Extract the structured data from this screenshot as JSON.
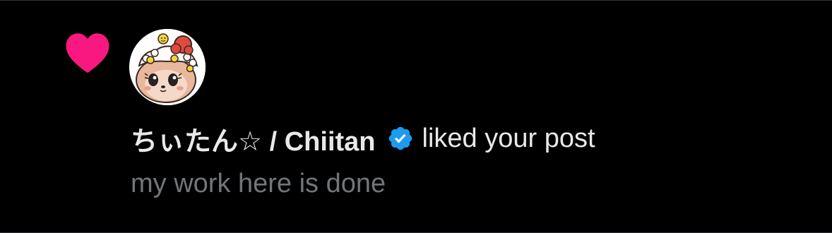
{
  "notification": {
    "type_icon": "heart-icon",
    "user": {
      "display_name": "ちぃたん☆ / Chiitan",
      "verified": true,
      "verified_icon": "verified-badge-icon"
    },
    "action_text": "liked your post",
    "post_excerpt": "my work here is done"
  },
  "colors": {
    "heart": "#f91880",
    "verified": "#1d9bf0",
    "primary_text": "#e7e9ea",
    "secondary_text": "#71767b",
    "background": "#000000"
  }
}
